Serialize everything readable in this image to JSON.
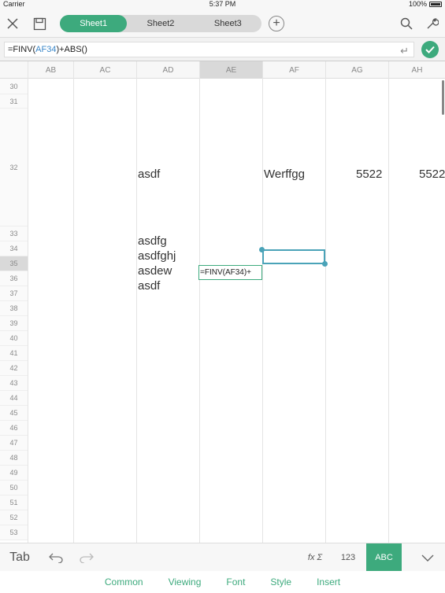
{
  "status": {
    "carrier": "Carrier",
    "time": "5:37 PM",
    "battery": "100%"
  },
  "toolbar": {
    "close_icon": "close-icon",
    "save_icon": "save-icon",
    "tabs": [
      "Sheet1",
      "Sheet2",
      "Sheet3"
    ],
    "active_tab": "Sheet1",
    "add_label": "+",
    "search_icon": "search-icon",
    "settings_icon": "wrench-icon"
  },
  "formula": {
    "prefix": "=FINV(",
    "ref": "AF34",
    "suffix": ")+ABS()"
  },
  "columns": [
    "AB",
    "AC",
    "AD",
    "AE",
    "AF",
    "AG",
    "AH"
  ],
  "selected_column": "AE",
  "rows": [
    "30",
    "31",
    "32",
    "33",
    "34",
    "35",
    "36",
    "37",
    "38",
    "39",
    "40",
    "41",
    "42",
    "43",
    "44",
    "45",
    "46",
    "47",
    "48",
    "49",
    "50",
    "51",
    "52",
    "53"
  ],
  "selected_row": "35",
  "cells": {
    "ad32": "asdf",
    "af32": "Werffgg",
    "ag32": "5522",
    "ah32": "5522",
    "ad33": "asdfg",
    "ad34": "asdfghj",
    "ad35": "asdew",
    "ad36": "asdf",
    "ae35_edit": "=FINV(AF34)+"
  },
  "keyboard_bar": {
    "tab": "Tab",
    "fx": "fx Σ",
    "num": "123",
    "abc": "ABC"
  },
  "menu": [
    "Common",
    "Viewing",
    "Font",
    "Style",
    "Insert"
  ],
  "colors": {
    "accent": "#3daa7d",
    "selection": "#4aa3b8",
    "ref": "#3a87c8"
  }
}
